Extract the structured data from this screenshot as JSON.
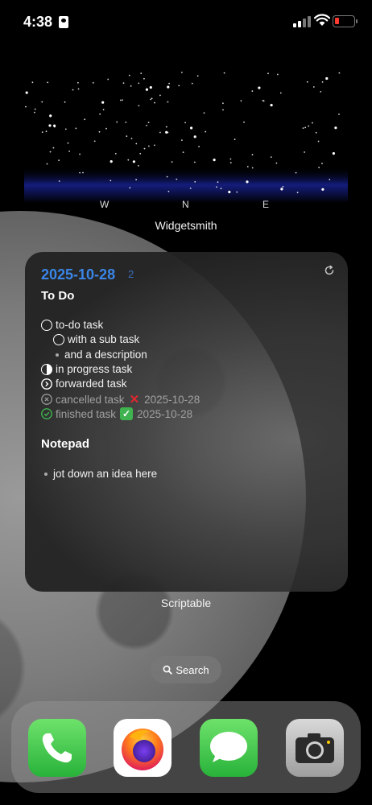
{
  "status_bar": {
    "time": "4:38"
  },
  "sky_widget": {
    "compass": [
      "W",
      "N",
      "E"
    ],
    "label": "Widgetsmith"
  },
  "todo_widget": {
    "date": "2025-10-28",
    "date_count": "2",
    "todo_heading": "To Do",
    "tasks": [
      {
        "text": "to-do task",
        "state": "open"
      },
      {
        "text": "with a sub task",
        "state": "open-sub"
      },
      {
        "text": "and a description",
        "state": "description"
      },
      {
        "text": "in progress task",
        "state": "in-progress"
      },
      {
        "text": "forwarded task",
        "state": "forwarded"
      },
      {
        "text": "cancelled task",
        "state": "cancelled",
        "date": "2025-10-28"
      },
      {
        "text": "finished task",
        "state": "finished",
        "date": "2025-10-28"
      }
    ],
    "notepad_heading": "Notepad",
    "notes": [
      "jot down an idea here"
    ],
    "label": "Scriptable"
  },
  "search": {
    "label": "Search"
  },
  "dock": {
    "apps": [
      "phone",
      "firefox",
      "messages",
      "camera"
    ]
  },
  "colors": {
    "date_blue": "#3a86e8",
    "finished_green": "#3fb34f",
    "cancel_red": "#e0282e",
    "battery_red": "#ff3b30"
  }
}
